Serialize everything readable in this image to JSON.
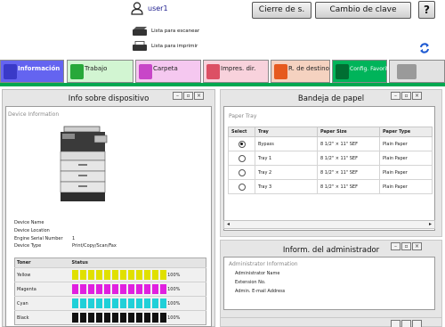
{
  "header": {
    "user_name": "user1",
    "logout_label": "Cierre de s.",
    "change_password_label": "Cambio de clave",
    "help_label": "?"
  },
  "status": {
    "scan_ready": "Lista para escanear",
    "print_ready": "Lista para imprimir"
  },
  "tabs": [
    {
      "label": "Información",
      "color": "#6464f0",
      "icon_color": "#3a3ac8"
    },
    {
      "label": "Trabajo",
      "color": "#d2f5d2",
      "icon_color": "#28a83a"
    },
    {
      "label": "Carpeta",
      "color": "#f5c8f0",
      "icon_color": "#c846c8"
    },
    {
      "label": "Impres. dir.",
      "color": "#f8d2dc",
      "icon_color": "#dc5064"
    },
    {
      "label": "R. de destino",
      "color": "#f5d2c0",
      "icon_color": "#e65a1e"
    },
    {
      "label": "Config. Favorita",
      "color": "#00b45a",
      "icon_color": "#006e32"
    },
    {
      "label": "",
      "color": "#e2e2e2",
      "icon_color": "#9a9a9a"
    }
  ],
  "device_panel": {
    "title": "Info sobre dispositivo",
    "section": "Device Information",
    "fields": [
      {
        "label": "Device Name",
        "value": ""
      },
      {
        "label": "Device Location",
        "value": ""
      },
      {
        "label": "Engine Serial Number",
        "value": "1"
      },
      {
        "label": "Device Type",
        "value": "Print/Copy/Scan/Fax"
      }
    ],
    "toner_headers": [
      "Toner",
      "Status"
    ],
    "toner": [
      {
        "name": "Yellow",
        "percent": "100%",
        "level": 1.0,
        "color": "#e0e000"
      },
      {
        "name": "Magenta",
        "percent": "100%",
        "level": 1.0,
        "color": "#e020e0"
      },
      {
        "name": "Cyan",
        "percent": "100%",
        "level": 1.0,
        "color": "#20d0d8"
      },
      {
        "name": "Black",
        "percent": "100%",
        "level": 1.0,
        "color": "#111111"
      }
    ]
  },
  "paper_panel": {
    "title": "Bandeja de papel",
    "section": "Paper Tray",
    "headers": [
      "Select",
      "Tray",
      "Paper Size",
      "Paper Type"
    ],
    "rows": [
      {
        "tray": "Bypass",
        "size": "8 1/2\" × 11\" SEF",
        "type": "Plain Paper",
        "selected": true
      },
      {
        "tray": "Tray 1",
        "size": "8 1/2\" × 11\" SEF",
        "type": "Plain Paper",
        "selected": false
      },
      {
        "tray": "Tray 2",
        "size": "8 1/2\" × 11\" SEF",
        "type": "Plain Paper",
        "selected": false
      },
      {
        "tray": "Tray 3",
        "size": "8 1/2\" × 11\" SEF",
        "type": "Plain Paper",
        "selected": false
      }
    ]
  },
  "admin_panel": {
    "title": "Inform. del administrador",
    "section": "Administrator Information",
    "fields": [
      "Administrator Name",
      "Extension No.",
      "Admin. E-mail Address"
    ]
  },
  "window_controls": {
    "minimize": "–",
    "restore": "▫",
    "close": "×"
  },
  "scroll": {
    "left": "◂",
    "right": "▸"
  }
}
